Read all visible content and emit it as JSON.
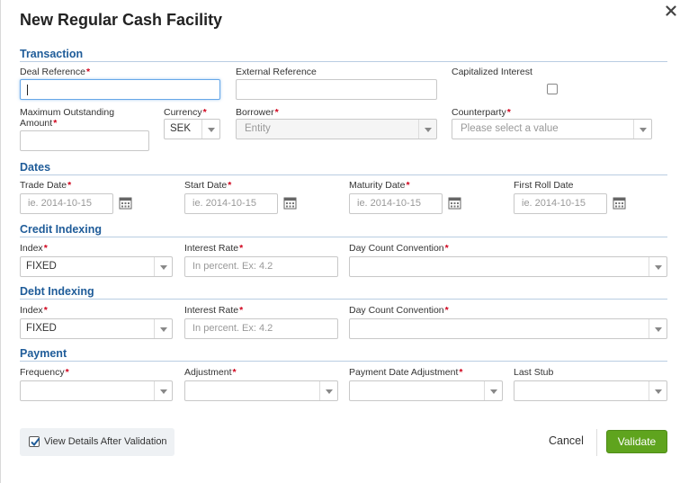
{
  "dialog": {
    "title": "New Regular Cash Facility",
    "close_glyph": "×"
  },
  "transaction": {
    "heading": "Transaction",
    "deal_reference_label": "Deal Reference",
    "deal_reference_value": "",
    "external_reference_label": "External Reference",
    "external_reference_value": "",
    "capitalized_interest_label": "Capitalized Interest",
    "capitalized_interest_checked": false,
    "max_outstanding_label_line1": "Maximum Outstanding",
    "max_outstanding_label_line2": "Amount",
    "max_outstanding_value": "",
    "currency_label": "Currency",
    "currency_value": "SEK",
    "borrower_label": "Borrower",
    "borrower_value": "Entity",
    "counterparty_label": "Counterparty",
    "counterparty_placeholder": "Please select a value"
  },
  "dates": {
    "heading": "Dates",
    "trade_date_label": "Trade Date",
    "start_date_label": "Start Date",
    "maturity_date_label": "Maturity Date",
    "first_roll_date_label": "First Roll Date",
    "date_placeholder": "ie. 2014-10-15"
  },
  "credit_indexing": {
    "heading": "Credit Indexing",
    "index_label": "Index",
    "index_value": "FIXED",
    "interest_rate_label": "Interest Rate",
    "interest_rate_placeholder": "In percent. Ex: 4.2",
    "day_count_label": "Day Count Convention",
    "day_count_value": ""
  },
  "debt_indexing": {
    "heading": "Debt Indexing",
    "index_label": "Index",
    "index_value": "FIXED",
    "interest_rate_label": "Interest Rate",
    "interest_rate_placeholder": "In percent. Ex: 4.2",
    "day_count_label": "Day Count Convention",
    "day_count_value": ""
  },
  "payment": {
    "heading": "Payment",
    "frequency_label": "Frequency",
    "adjustment_label": "Adjustment",
    "payment_date_adjustment_label": "Payment Date Adjustment",
    "last_stub_label": "Last Stub"
  },
  "footer": {
    "view_details_label": "View Details After Validation",
    "view_details_checked": true,
    "cancel_label": "Cancel",
    "validate_label": "Validate"
  },
  "required_marker": "*",
  "colors": {
    "section_heading": "#1f5c99",
    "required": "#d0021b",
    "validate_button": "#5fa41e"
  }
}
